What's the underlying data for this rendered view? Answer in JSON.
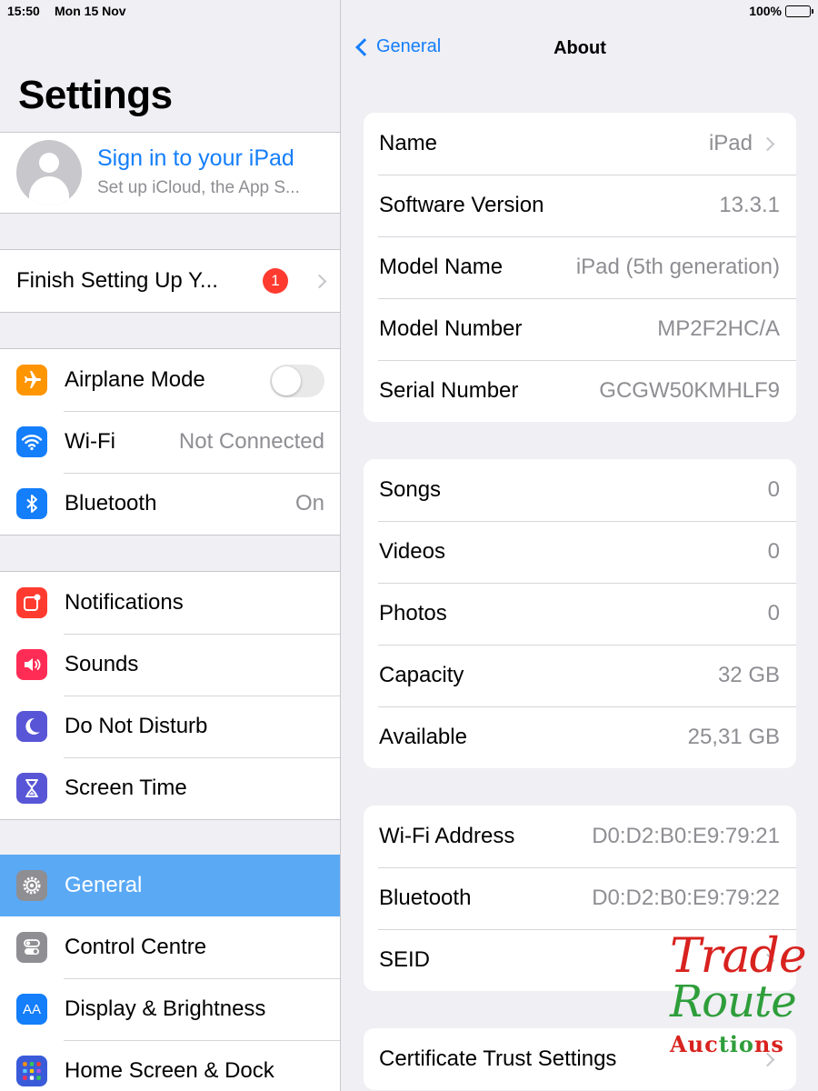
{
  "status_bar": {
    "time": "15:50",
    "date": "Mon 15 Nov",
    "battery": "100%"
  },
  "sidebar": {
    "title": "Settings",
    "profile": {
      "title": "Sign in to your iPad",
      "subtitle": "Set up iCloud, the App S..."
    },
    "finish_setup": {
      "label": "Finish Setting Up Y...",
      "badge": "1"
    },
    "groups": [
      [
        {
          "label": "Airplane Mode",
          "icon": "airplane-icon",
          "color": "#ff9500",
          "toggle": false
        },
        {
          "label": "Wi-Fi",
          "icon": "wifi-icon",
          "color": "#147efb",
          "value": "Not Connected"
        },
        {
          "label": "Bluetooth",
          "icon": "bluetooth-icon",
          "color": "#147efb",
          "value": "On"
        }
      ],
      [
        {
          "label": "Notifications",
          "icon": "notifications-icon",
          "color": "#ff3b30"
        },
        {
          "label": "Sounds",
          "icon": "sounds-icon",
          "color": "#ff2d55"
        },
        {
          "label": "Do Not Disturb",
          "icon": "moon-icon",
          "color": "#5856d6"
        },
        {
          "label": "Screen Time",
          "icon": "hourglass-icon",
          "color": "#5856d6"
        }
      ],
      [
        {
          "label": "General",
          "icon": "gear-icon",
          "color": "#8e8e93",
          "selected": true
        },
        {
          "label": "Control Centre",
          "icon": "control-centre-icon",
          "color": "#8e8e93"
        },
        {
          "label": "Display & Brightness",
          "icon": "display-icon",
          "color": "#147efb",
          "glyph": "AA"
        },
        {
          "label": "Home Screen & Dock",
          "icon": "home-screen-icon",
          "color": "#3a5bd9"
        }
      ]
    ]
  },
  "nav": {
    "back_label": "General",
    "title": "About"
  },
  "about": {
    "device": [
      {
        "label": "Name",
        "value": "iPad",
        "chevron": true
      },
      {
        "label": "Software Version",
        "value": "13.3.1"
      },
      {
        "label": "Model Name",
        "value": "iPad (5th generation)"
      },
      {
        "label": "Model Number",
        "value": "MP2F2HC/A"
      },
      {
        "label": "Serial Number",
        "value": "GCGW50KMHLF9"
      }
    ],
    "media": [
      {
        "label": "Songs",
        "value": "0"
      },
      {
        "label": "Videos",
        "value": "0"
      },
      {
        "label": "Photos",
        "value": "0"
      },
      {
        "label": "Capacity",
        "value": "32 GB"
      },
      {
        "label": "Available",
        "value": "25,31 GB"
      }
    ],
    "network": [
      {
        "label": "Wi-Fi Address",
        "value": "D0:D2:B0:E9:79:21"
      },
      {
        "label": "Bluetooth",
        "value": "D0:D2:B0:E9:79:22"
      },
      {
        "label": "SEID",
        "value": "",
        "chevron": true
      }
    ],
    "certificate": {
      "label": "Certificate Trust Settings"
    }
  },
  "watermark": {
    "line1": "Trade",
    "line2": "Route",
    "line3": "Auctions"
  }
}
